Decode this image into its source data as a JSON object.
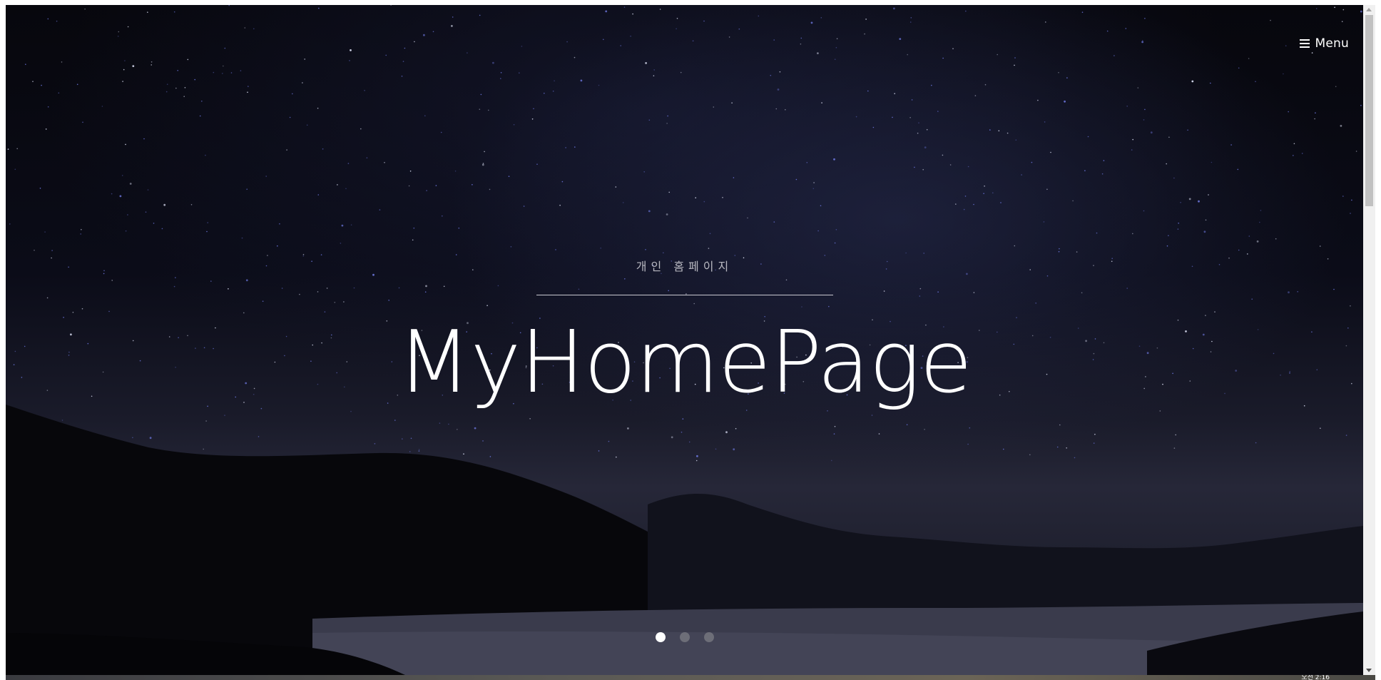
{
  "header": {
    "menu_label": "Menu",
    "menu_icon": "hamburger-icon"
  },
  "hero": {
    "subtitle": "개인 홈페이지",
    "title": "MyHomePage"
  },
  "slider": {
    "slide_count": 3,
    "active_index": 0
  },
  "taskbar": {
    "clock_text": "오전 2:16"
  },
  "colors": {
    "text_primary": "#ffffff",
    "dot_inactive": "#6d6e78",
    "dot_active": "#ffffff"
  }
}
